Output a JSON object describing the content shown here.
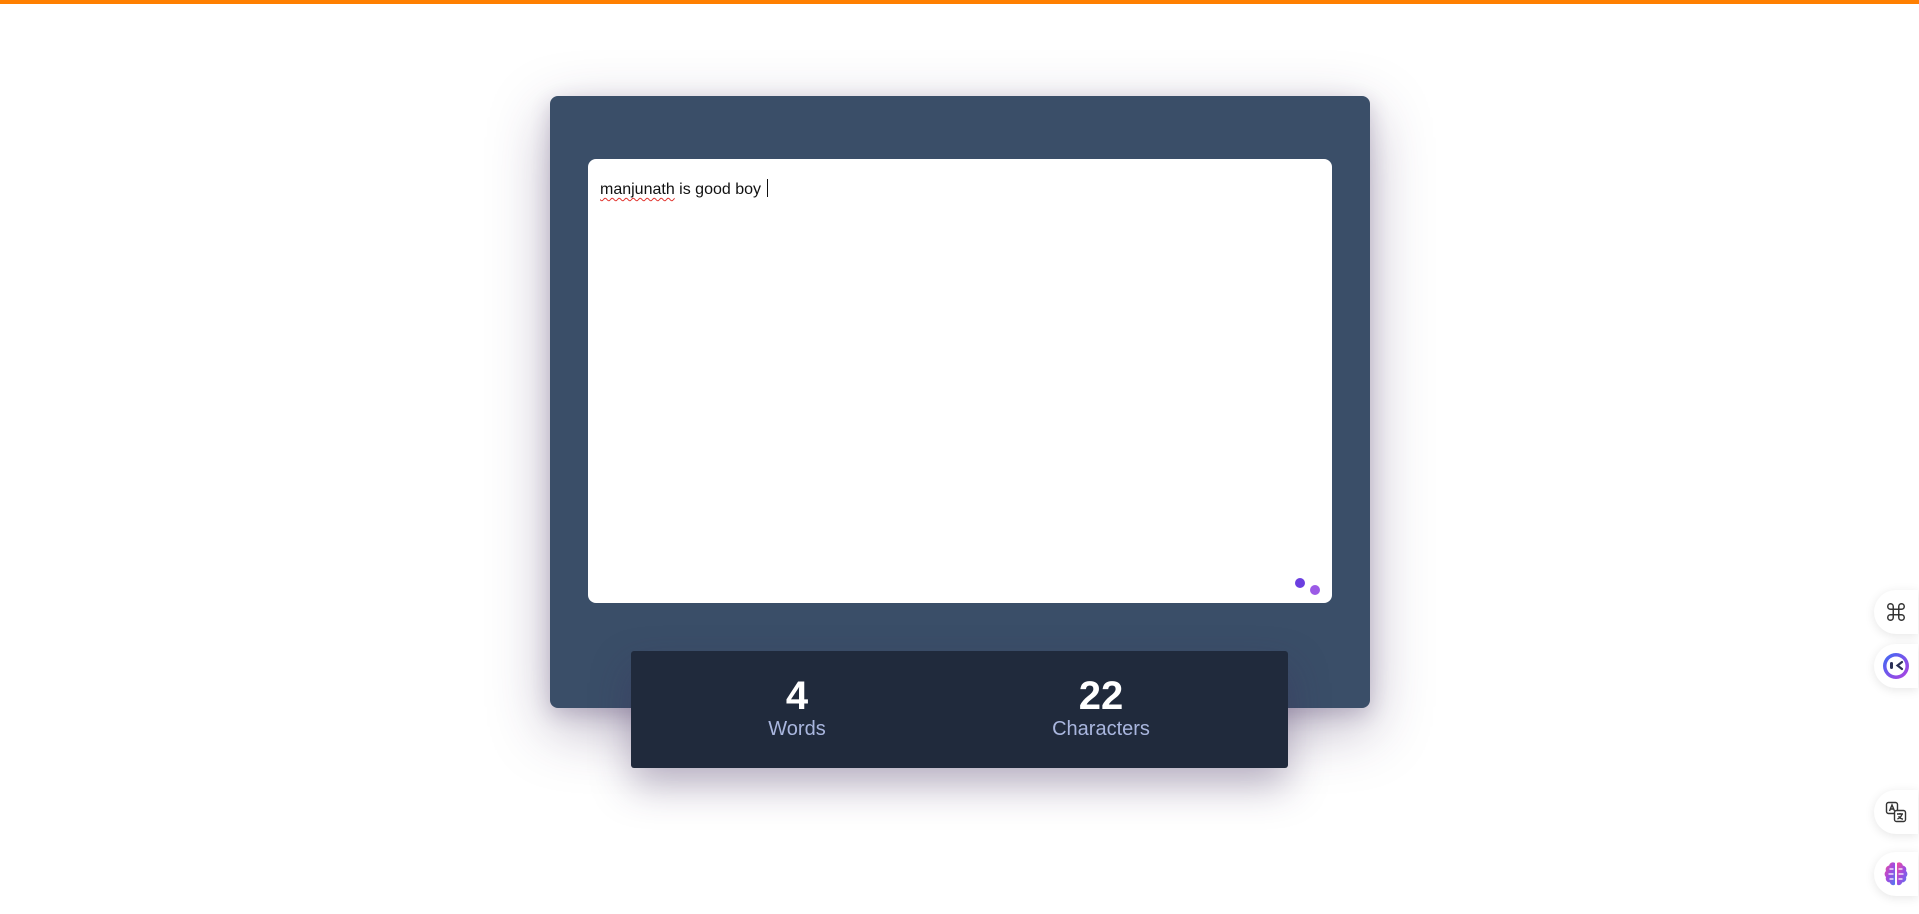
{
  "editor": {
    "text_misspelled": "manjunath",
    "text_rest": " is good boy "
  },
  "stats": {
    "words": {
      "value": "4",
      "label": "Words"
    },
    "characters": {
      "value": "22",
      "label": "Characters"
    }
  },
  "side_tools": [
    {
      "icon": "command-icon"
    },
    {
      "icon": "assistant-face-icon"
    },
    {
      "icon": "translate-icon"
    },
    {
      "icon": "brain-icon"
    }
  ],
  "colors": {
    "top_bar": "#ff7f00",
    "card": "#3a4e68",
    "stats_panel": "#202a3c",
    "stat_label": "#a9b6de",
    "accent_dots": "#7b4ae2"
  }
}
